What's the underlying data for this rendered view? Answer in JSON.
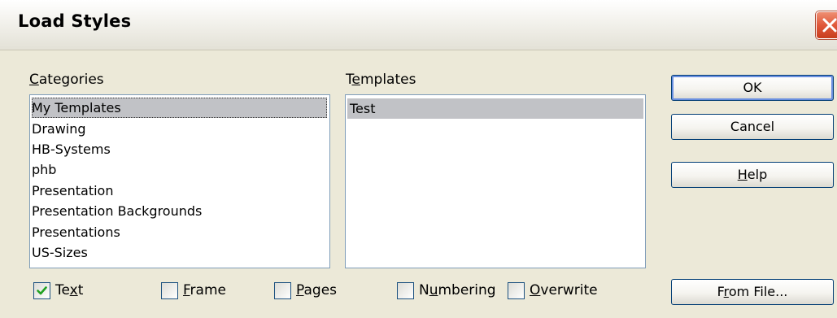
{
  "window": {
    "title": "Load Styles"
  },
  "categories": {
    "label_mnemonic": "C",
    "label_rest": "ategories",
    "items": [
      "My Templates",
      "Drawing",
      "HB-Systems",
      "phb",
      "Presentation",
      "Presentation Backgrounds",
      "Presentations",
      "US-Sizes"
    ],
    "selected": "My Templates"
  },
  "templates": {
    "label_pre": "T",
    "label_mnemonic": "e",
    "label_rest": "mplates",
    "items": [
      "Test"
    ],
    "selected": "Test"
  },
  "buttons": {
    "ok": "OK",
    "cancel": "Cancel",
    "help_mnemonic": "H",
    "help_rest": "elp",
    "from_file_pre": "F",
    "from_file_mnemonic": "r",
    "from_file_rest": "om File..."
  },
  "options": {
    "text": {
      "pre": "Te",
      "mnemonic": "x",
      "rest": "t",
      "checked": true
    },
    "frame": {
      "pre": "",
      "mnemonic": "F",
      "rest": "rame",
      "checked": false
    },
    "pages": {
      "pre": "",
      "mnemonic": "P",
      "rest": "ages",
      "checked": false
    },
    "numbering": {
      "pre": "N",
      "mnemonic": "u",
      "rest": "mbering",
      "checked": false
    },
    "overwrite": {
      "pre": "",
      "mnemonic": "O",
      "rest": "verwrite",
      "checked": false
    }
  },
  "icons": {
    "close": "close-icon",
    "checkmark": "checkmark-icon"
  },
  "colors": {
    "selection": "#c1c2c6",
    "close_button": "#e0583a",
    "checkmark": "#21a121",
    "dialog_bg": "#ece9d8"
  }
}
